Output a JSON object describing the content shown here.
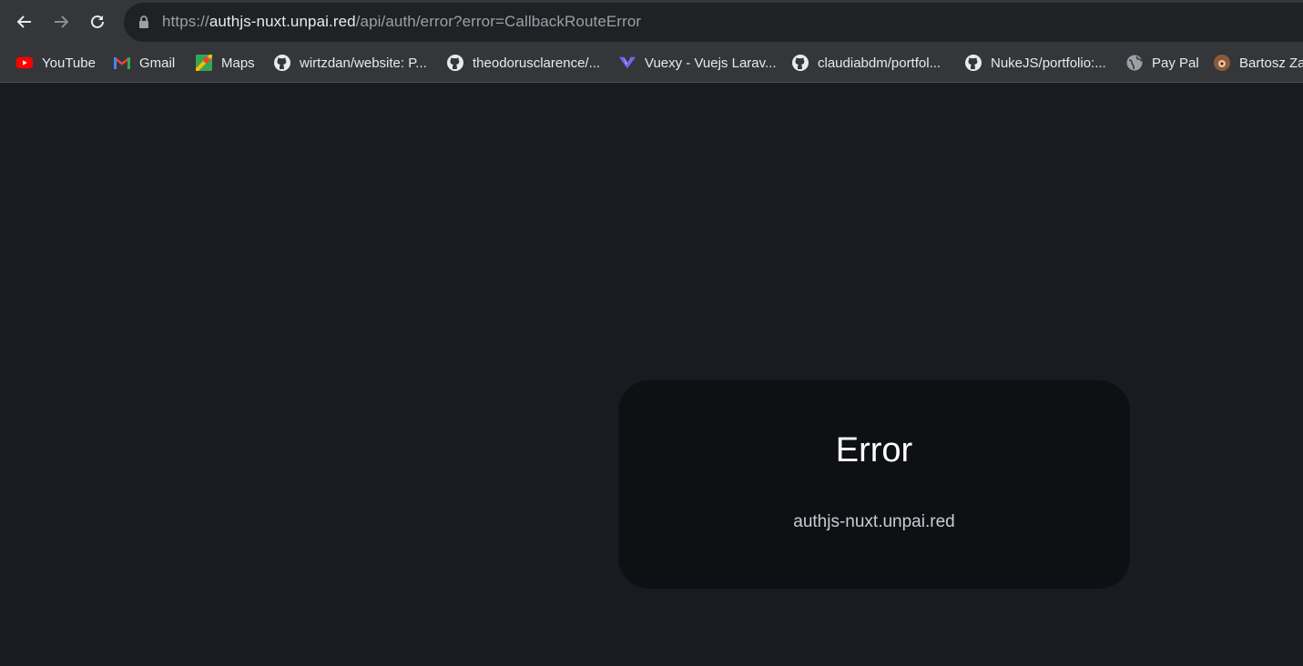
{
  "browser": {
    "url_scheme": "https://",
    "url_host": "authjs-nuxt.unpai.red",
    "url_path": "/api/auth/error?error=CallbackRouteError"
  },
  "bookmarks": [
    {
      "label": "YouTube",
      "icon": "youtube-icon"
    },
    {
      "label": "Gmail",
      "icon": "gmail-icon"
    },
    {
      "label": "Maps",
      "icon": "maps-icon"
    },
    {
      "label": "wirtzdan/website: P...",
      "icon": "github-icon"
    },
    {
      "label": "theodorusclarence/...",
      "icon": "github-icon"
    },
    {
      "label": "Vuexy - Vuejs Larav...",
      "icon": "vuexy-icon"
    },
    {
      "label": "claudiabdm/portfol...",
      "icon": "github-icon"
    },
    {
      "label": "NukeJS/portfolio:...",
      "icon": "github-icon"
    },
    {
      "label": "Pay Pal",
      "icon": "globe-icon"
    },
    {
      "label": "Bartosz Za",
      "icon": "avatar-icon"
    }
  ],
  "error_card": {
    "title": "Error",
    "message": "authjs-nuxt.unpai.red"
  },
  "colors": {
    "page_background": "#181b22",
    "card_background": "#0e1014",
    "toolbar": "#35363a"
  }
}
